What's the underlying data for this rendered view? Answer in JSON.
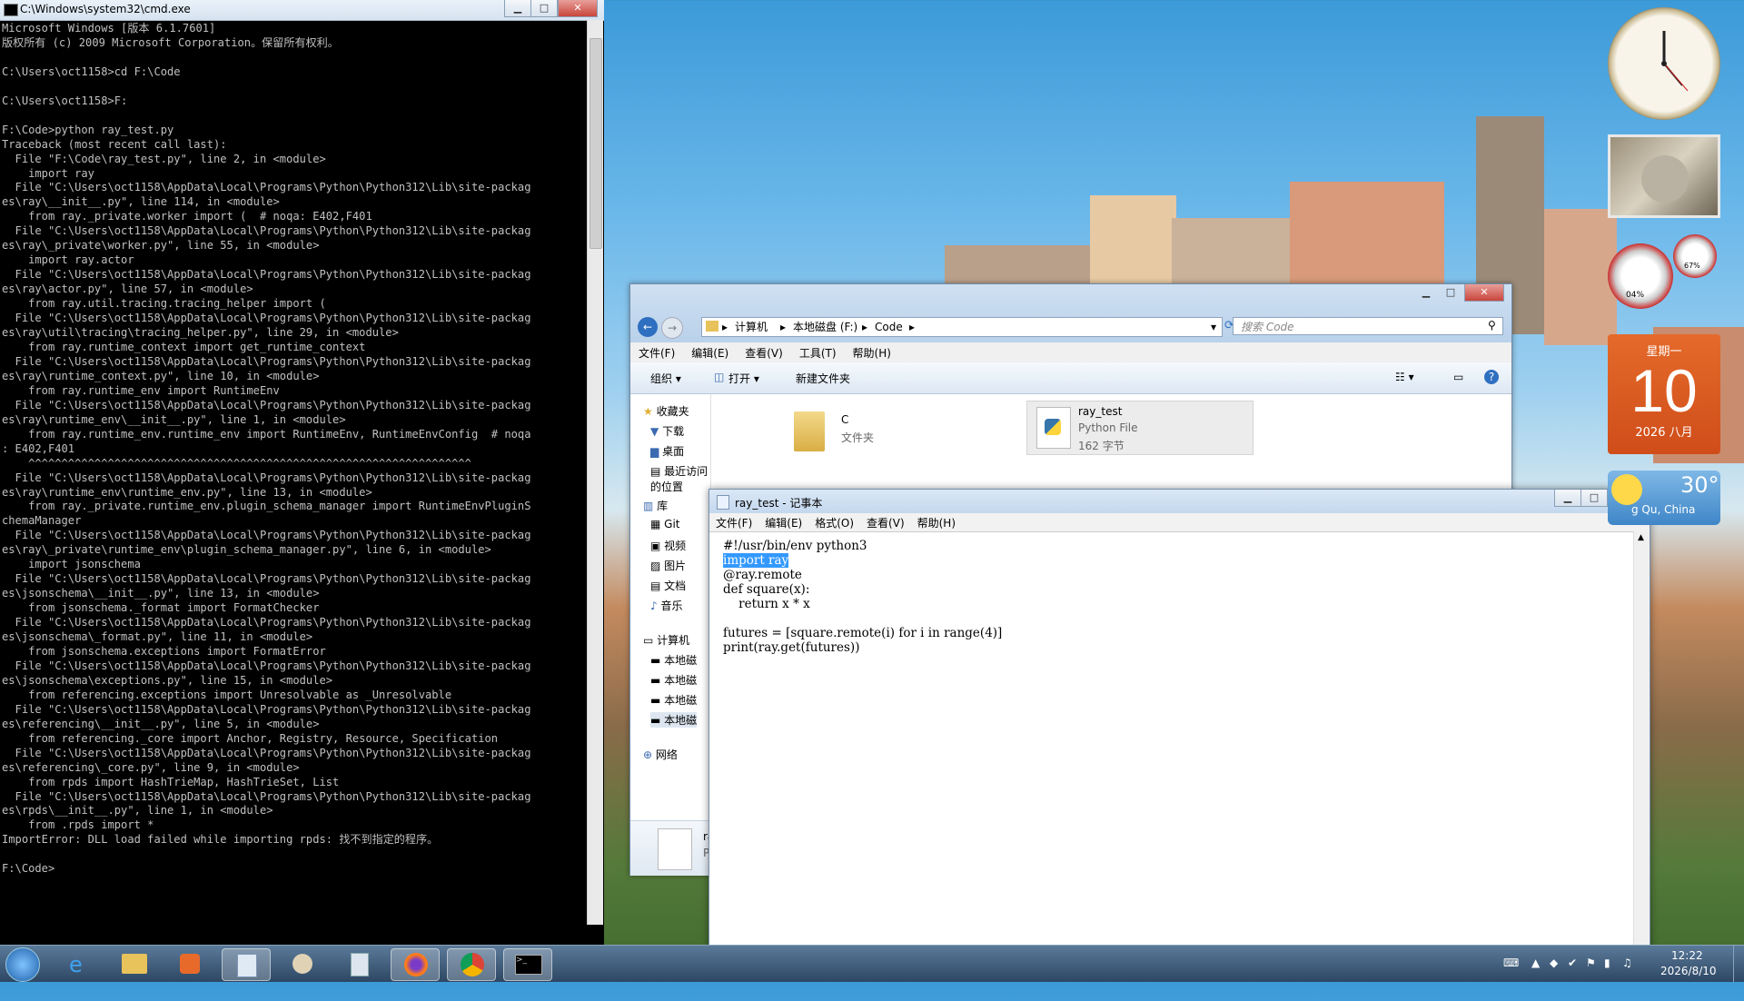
{
  "cmd": {
    "title": "C:\\Windows\\system32\\cmd.exe",
    "lines": [
      "Microsoft Windows [版本 6.1.7601]",
      "版权所有 (c) 2009 Microsoft Corporation。保留所有权利。",
      "",
      "C:\\Users\\oct1158>cd F:\\Code",
      "",
      "C:\\Users\\oct1158>F:",
      "",
      "F:\\Code>python ray_test.py",
      "Traceback (most recent call last):",
      "  File \"F:\\Code\\ray_test.py\", line 2, in <module>",
      "    import ray",
      "  File \"C:\\Users\\oct1158\\AppData\\Local\\Programs\\Python\\Python312\\Lib\\site-packag",
      "es\\ray\\__init__.py\", line 114, in <module>",
      "    from ray._private.worker import (  # noqa: E402,F401",
      "  File \"C:\\Users\\oct1158\\AppData\\Local\\Programs\\Python\\Python312\\Lib\\site-packag",
      "es\\ray\\_private\\worker.py\", line 55, in <module>",
      "    import ray.actor",
      "  File \"C:\\Users\\oct1158\\AppData\\Local\\Programs\\Python\\Python312\\Lib\\site-packag",
      "es\\ray\\actor.py\", line 57, in <module>",
      "    from ray.util.tracing.tracing_helper import (",
      "  File \"C:\\Users\\oct1158\\AppData\\Local\\Programs\\Python\\Python312\\Lib\\site-packag",
      "es\\ray\\util\\tracing\\tracing_helper.py\", line 29, in <module>",
      "    from ray.runtime_context import get_runtime_context",
      "  File \"C:\\Users\\oct1158\\AppData\\Local\\Programs\\Python\\Python312\\Lib\\site-packag",
      "es\\ray\\runtime_context.py\", line 10, in <module>",
      "    from ray.runtime_env import RuntimeEnv",
      "  File \"C:\\Users\\oct1158\\AppData\\Local\\Programs\\Python\\Python312\\Lib\\site-packag",
      "es\\ray\\runtime_env\\__init__.py\", line 1, in <module>",
      "    from ray.runtime_env.runtime_env import RuntimeEnv, RuntimeEnvConfig  # noqa",
      ": E402,F401",
      "    ^^^^^^^^^^^^^^^^^^^^^^^^^^^^^^^^^^^^^^^^^^^^^^^^^^^^^^^^^^^^^^^^^^^",
      "  File \"C:\\Users\\oct1158\\AppData\\Local\\Programs\\Python\\Python312\\Lib\\site-packag",
      "es\\ray\\runtime_env\\runtime_env.py\", line 13, in <module>",
      "    from ray._private.runtime_env.plugin_schema_manager import RuntimeEnvPluginS",
      "chemaManager",
      "  File \"C:\\Users\\oct1158\\AppData\\Local\\Programs\\Python\\Python312\\Lib\\site-packag",
      "es\\ray\\_private\\runtime_env\\plugin_schema_manager.py\", line 6, in <module>",
      "    import jsonschema",
      "  File \"C:\\Users\\oct1158\\AppData\\Local\\Programs\\Python\\Python312\\Lib\\site-packag",
      "es\\jsonschema\\__init__.py\", line 13, in <module>",
      "    from jsonschema._format import FormatChecker",
      "  File \"C:\\Users\\oct1158\\AppData\\Local\\Programs\\Python\\Python312\\Lib\\site-packag",
      "es\\jsonschema\\_format.py\", line 11, in <module>",
      "    from jsonschema.exceptions import FormatError",
      "  File \"C:\\Users\\oct1158\\AppData\\Local\\Programs\\Python\\Python312\\Lib\\site-packag",
      "es\\jsonschema\\exceptions.py\", line 15, in <module>",
      "    from referencing.exceptions import Unresolvable as _Unresolvable",
      "  File \"C:\\Users\\oct1158\\AppData\\Local\\Programs\\Python\\Python312\\Lib\\site-packag",
      "es\\referencing\\__init__.py\", line 5, in <module>",
      "    from referencing._core import Anchor, Registry, Resource, Specification",
      "  File \"C:\\Users\\oct1158\\AppData\\Local\\Programs\\Python\\Python312\\Lib\\site-packag",
      "es\\referencing\\_core.py\", line 9, in <module>",
      "    from rpds import HashTrieMap, HashTrieSet, List",
      "  File \"C:\\Users\\oct1158\\AppData\\Local\\Programs\\Python\\Python312\\Lib\\site-packag",
      "es\\rpds\\__init__.py\", line 1, in <module>",
      "    from .rpds import *",
      "ImportError: DLL load failed while importing rpds: 找不到指定的程序。",
      "",
      "F:\\Code>"
    ]
  },
  "explorer": {
    "breadcrumb": [
      "计算机",
      "本地磁盘 (F:)",
      "Code"
    ],
    "search_placeholder": "搜索 Code",
    "menu": [
      "文件(F)",
      "编辑(E)",
      "查看(V)",
      "工具(T)",
      "帮助(H)"
    ],
    "toolbar": {
      "organize": "组织 ▾",
      "open": "打开 ▾",
      "new_folder": "新建文件夹"
    },
    "nav": {
      "favorites": "收藏夹",
      "downloads": "下载",
      "desktop": "桌面",
      "recent": "最近访问的位置",
      "libraries": "库",
      "git": "Git",
      "videos": "视频",
      "pictures": "图片",
      "documents": "文档",
      "music": "音乐",
      "computer": "计算机",
      "disk1": "本地磁",
      "disk2": "本地磁",
      "disk3": "本地磁",
      "disk4": "本地磁",
      "network": "网络"
    },
    "files": [
      {
        "name": "C",
        "type": "文件夹",
        "size": ""
      },
      {
        "name": "ray_test",
        "type": "Python File",
        "size": "162 字节"
      }
    ],
    "details_partial_name": "ra",
    "details_partial_type": "P"
  },
  "notepad": {
    "title": "ray_test - 记事本",
    "menu": [
      "文件(F)",
      "编辑(E)",
      "格式(O)",
      "查看(V)",
      "帮助(H)"
    ],
    "line1": "#!/usr/bin/env python3",
    "line2_selected": "import ray",
    "rest": "\n@ray.remote\ndef square(x):\n    return x * x\n\nfutures = [square.remote(i) for i in range(4)]\nprint(ray.get(futures))"
  },
  "gadgets": {
    "calendar_weekday": "星期一",
    "calendar_day": "10",
    "calendar_month": "2026 八月",
    "weather_temp": "30°",
    "weather_loc": "g Qu, China",
    "cpu_pct": "04%",
    "mem_pct": "67%"
  },
  "taskbar": {
    "time": "12:22",
    "date": "2026/8/10"
  }
}
